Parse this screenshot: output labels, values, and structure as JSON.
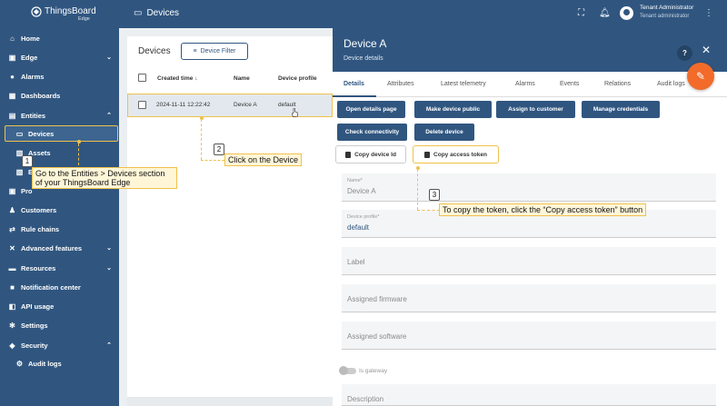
{
  "sidebar": {
    "logo_text": "ThingsBoard",
    "logo_sub": "Edge",
    "items": [
      {
        "label": "Home",
        "icon": "home-icon"
      },
      {
        "label": "Edge",
        "icon": "edge-icon"
      },
      {
        "label": "Alarms",
        "icon": "alarm-icon"
      },
      {
        "label": "Dashboards",
        "icon": "dashboard-icon"
      },
      {
        "label": "Entities",
        "icon": "entities-icon"
      },
      {
        "label": "Devices",
        "icon": "devices-icon"
      },
      {
        "label": "Assets",
        "icon": "assets-icon"
      },
      {
        "label": "E",
        "icon": "entity-views-icon"
      },
      {
        "label": "Pro",
        "icon": "profiles-icon"
      },
      {
        "label": "Customers",
        "icon": "customers-icon"
      },
      {
        "label": "Rule chains",
        "icon": "rule-chains-icon"
      },
      {
        "label": "Advanced features",
        "icon": "advanced-icon"
      },
      {
        "label": "Resources",
        "icon": "resources-icon"
      },
      {
        "label": "Notification center",
        "icon": "notification-icon"
      },
      {
        "label": "API usage",
        "icon": "api-usage-icon"
      },
      {
        "label": "Settings",
        "icon": "settings-icon"
      },
      {
        "label": "Security",
        "icon": "security-icon"
      },
      {
        "label": "Audit logs",
        "icon": "audit-logs-icon"
      }
    ]
  },
  "topbar": {
    "title": "Devices",
    "user_name": "Tenant Administrator",
    "user_role": "Tenant administrator"
  },
  "devices": {
    "title": "Devices",
    "filter_label": "Device Filter",
    "columns": [
      "Created time",
      "Name",
      "Device profile"
    ],
    "rows": [
      {
        "created": "2024-11-11 12:22:42",
        "name": "Device A",
        "profile": "default"
      }
    ]
  },
  "details": {
    "title": "Device A",
    "subtitle": "Device details",
    "tabs": [
      "Details",
      "Attributes",
      "Latest telemetry",
      "Alarms",
      "Events",
      "Relations",
      "Audit logs"
    ],
    "buttons": {
      "open_details": "Open details page",
      "make_public": "Make device public",
      "assign_customer": "Assign to customer",
      "manage_credentials": "Manage credentials",
      "check_connectivity": "Check connectivity",
      "delete_device": "Delete device",
      "copy_device_id": "Copy device Id",
      "copy_access_token": "Copy access token"
    },
    "fields": {
      "name_label": "Name*",
      "name_value": "Device A",
      "profile_label": "Device profile*",
      "profile_value": "default",
      "label_ph": "Label",
      "firmware_ph": "Assigned firmware",
      "software_ph": "Assigned software",
      "gateway_label": "Is gateway",
      "description_ph": "Description"
    }
  },
  "callouts": {
    "step1_num": "1",
    "step1_text_l1": "Go to the Entities > Devices section",
    "step1_text_l2": "of your ThingsBoard Edge",
    "step2_num": "2",
    "step2_text": "Click on the Device",
    "step3_num": "3",
    "step3_text": "To copy the token, click the “Copy access token” button"
  },
  "colors": {
    "primary": "#305680",
    "accent": "#f26b2a",
    "highlight": "#f0c14b"
  }
}
